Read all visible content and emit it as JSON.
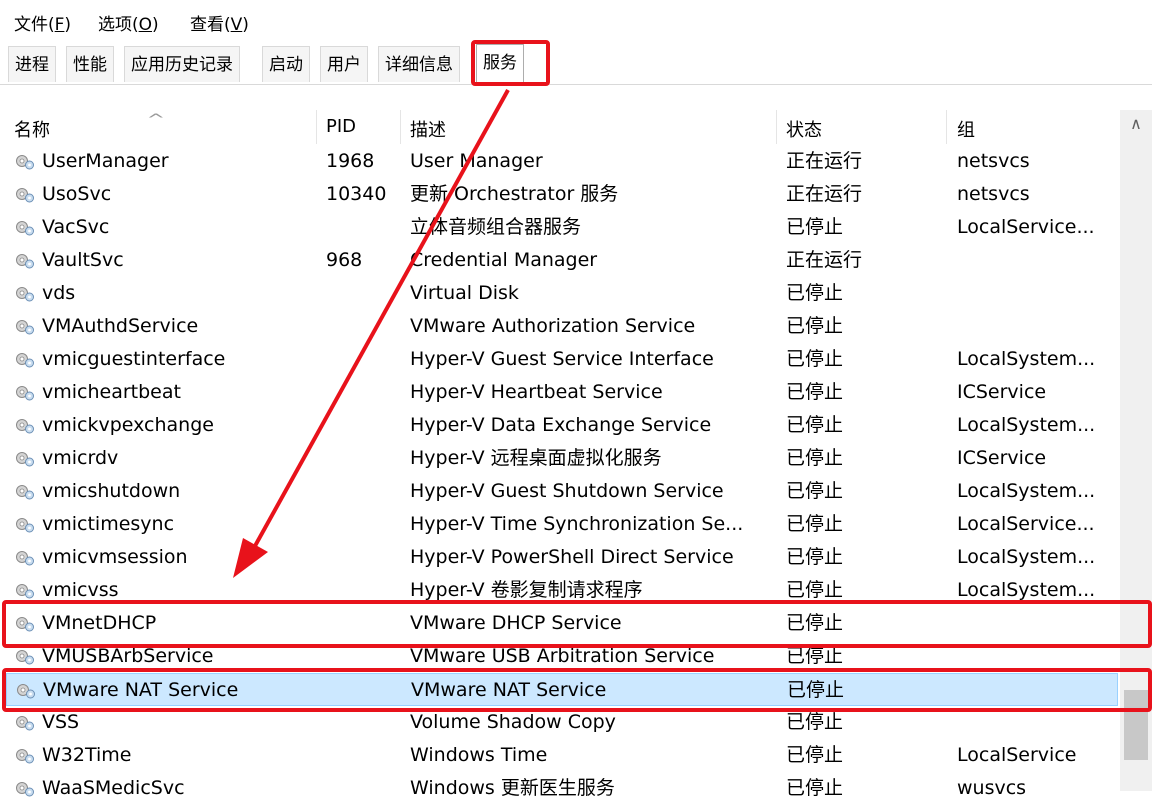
{
  "menu": {
    "file": "文件(",
    "file_key": "F",
    "file_end": ")",
    "options": "选项(",
    "options_key": "O",
    "options_end": ")",
    "view": "查看(",
    "view_key": "V",
    "view_end": ")"
  },
  "tabs": [
    "进程",
    "性能",
    "应用历史记录",
    "启动",
    "用户",
    "详细信息",
    "服务"
  ],
  "active_tab": "服务",
  "columns": {
    "name": "名称",
    "pid": "PID",
    "desc": "描述",
    "status": "状态",
    "group": "组"
  },
  "rows": [
    {
      "name": "UserManager",
      "pid": "1968",
      "desc": "User Manager",
      "status": "正在运行",
      "group": "netsvcs"
    },
    {
      "name": "UsoSvc",
      "pid": "10340",
      "desc": "更新 Orchestrator 服务",
      "status": "正在运行",
      "group": "netsvcs"
    },
    {
      "name": "VacSvc",
      "pid": "",
      "desc": "立体音频组合器服务",
      "status": "已停止",
      "group": "LocalService..."
    },
    {
      "name": "VaultSvc",
      "pid": "968",
      "desc": "Credential Manager",
      "status": "正在运行",
      "group": ""
    },
    {
      "name": "vds",
      "pid": "",
      "desc": "Virtual Disk",
      "status": "已停止",
      "group": ""
    },
    {
      "name": "VMAuthdService",
      "pid": "",
      "desc": "VMware Authorization Service",
      "status": "已停止",
      "group": ""
    },
    {
      "name": "vmicguestinterface",
      "pid": "",
      "desc": "Hyper-V Guest Service Interface",
      "status": "已停止",
      "group": "LocalSystem..."
    },
    {
      "name": "vmicheartbeat",
      "pid": "",
      "desc": "Hyper-V Heartbeat Service",
      "status": "已停止",
      "group": "ICService"
    },
    {
      "name": "vmickvpexchange",
      "pid": "",
      "desc": "Hyper-V Data Exchange Service",
      "status": "已停止",
      "group": "LocalSystem..."
    },
    {
      "name": "vmicrdv",
      "pid": "",
      "desc": "Hyper-V 远程桌面虚拟化服务",
      "status": "已停止",
      "group": "ICService"
    },
    {
      "name": "vmicshutdown",
      "pid": "",
      "desc": "Hyper-V Guest Shutdown Service",
      "status": "已停止",
      "group": "LocalSystem..."
    },
    {
      "name": "vmictimesync",
      "pid": "",
      "desc": "Hyper-V Time Synchronization Se...",
      "status": "已停止",
      "group": "LocalService..."
    },
    {
      "name": "vmicvmsession",
      "pid": "",
      "desc": "Hyper-V PowerShell Direct Service",
      "status": "已停止",
      "group": "LocalSystem..."
    },
    {
      "name": "vmicvss",
      "pid": "",
      "desc": "Hyper-V 卷影复制请求程序",
      "status": "已停止",
      "group": "LocalSystem..."
    },
    {
      "name": "VMnetDHCP",
      "pid": "",
      "desc": "VMware DHCP Service",
      "status": "已停止",
      "group": ""
    },
    {
      "name": "VMUSBArbService",
      "pid": "",
      "desc": "VMware USB Arbitration Service",
      "status": "已停止",
      "group": ""
    },
    {
      "name": "VMware NAT Service",
      "pid": "",
      "desc": "VMware NAT Service",
      "status": "已停止",
      "group": ""
    },
    {
      "name": "VSS",
      "pid": "",
      "desc": "Volume Shadow Copy",
      "status": "已停止",
      "group": ""
    },
    {
      "name": "W32Time",
      "pid": "",
      "desc": "Windows Time",
      "status": "已停止",
      "group": "LocalService"
    },
    {
      "name": "WaaSMedicSvc",
      "pid": "",
      "desc": "Windows 更新医生服务",
      "status": "已停止",
      "group": "wusvcs"
    }
  ],
  "selected_row": "VMware NAT Service",
  "highlighted_rows": [
    "VMnetDHCP",
    "VMware NAT Service"
  ],
  "colors": {
    "annotation_red": "#e8121b",
    "selection_bg": "#cce8ff",
    "selection_border": "#99d1ff"
  },
  "icons": {
    "service": "service-gear-icon",
    "scroll_up": "chevron-up-icon",
    "sort": "sort-ascending-icon"
  }
}
